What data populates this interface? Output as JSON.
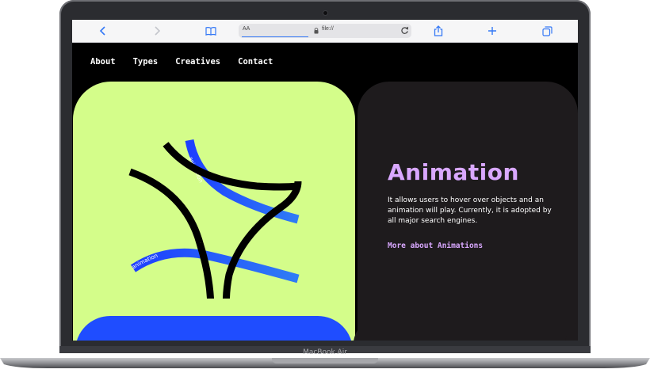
{
  "device": {
    "model_label": "MacBook Air"
  },
  "browser": {
    "address_prefix": "AA",
    "url": "file://",
    "icons": {
      "back": "chevron-left-icon",
      "forward": "chevron-right-icon",
      "bookmarks": "book-icon",
      "reload": "reload-icon",
      "share": "share-icon",
      "new_tab": "plus-icon",
      "tabs": "tabs-icon"
    }
  },
  "nav": {
    "items": [
      {
        "label": "About"
      },
      {
        "label": "Types"
      },
      {
        "label": "Creatives"
      },
      {
        "label": "Contact"
      }
    ]
  },
  "hero": {
    "graphic_texts": [
      "animation",
      "animation"
    ],
    "title": "Animation",
    "description": "It allows users to hover over objects and an animation will play. Currently, it is adopted by all major search engines.",
    "link_label": "More about Animations"
  },
  "colors": {
    "card_green": "#d4fd8a",
    "card_dark": "#1e1b1d",
    "accent_purple": "#d9a8ff",
    "accent_blue": "#1f4dff",
    "browser_blue": "#3478f6"
  }
}
